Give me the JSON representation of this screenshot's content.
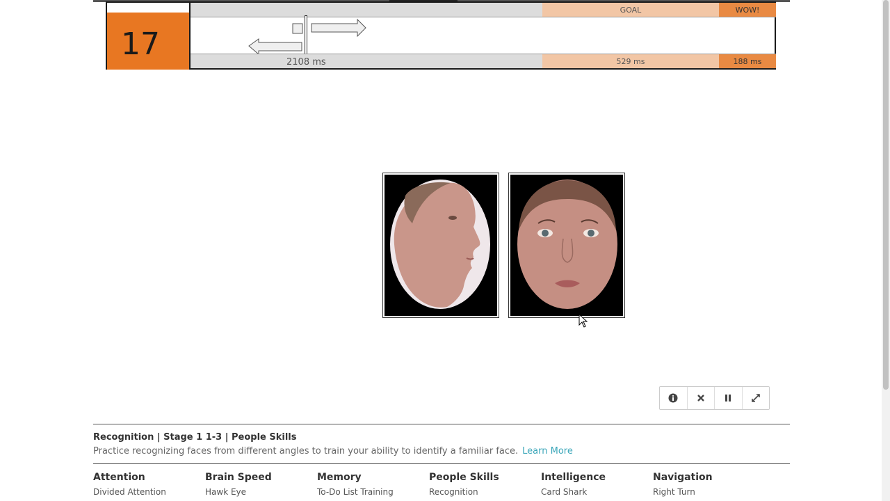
{
  "hud": {
    "score": "17",
    "goal_label": "GOAL",
    "wow_label": "WOW!",
    "current_ms": "2108 ms",
    "goal_ms": "529 ms",
    "wow_ms": "188 ms"
  },
  "controls": {
    "info_icon": "info-icon",
    "close_icon": "close-icon",
    "pause_icon": "pause-icon",
    "fullscreen_icon": "fullscreen-icon"
  },
  "game": {
    "title": "Recognition | Stage 1 1-3 | People Skills",
    "description": "Practice recognizing faces from different angles to train your ability to identify a familiar face.",
    "learn_more": "Learn More"
  },
  "categories": [
    {
      "name": "Attention",
      "item": "Divided Attention"
    },
    {
      "name": "Brain Speed",
      "item": "Hawk Eye"
    },
    {
      "name": "Memory",
      "item": "To-Do List Training"
    },
    {
      "name": "People Skills",
      "item": "Recognition"
    },
    {
      "name": "Intelligence",
      "item": "Card Shark"
    },
    {
      "name": "Navigation",
      "item": "Right Turn"
    }
  ],
  "colors": {
    "accent_orange": "#e87722",
    "goal_band": "#f2c6a5",
    "wow_band": "#e98a43",
    "link": "#3aa6b9"
  }
}
